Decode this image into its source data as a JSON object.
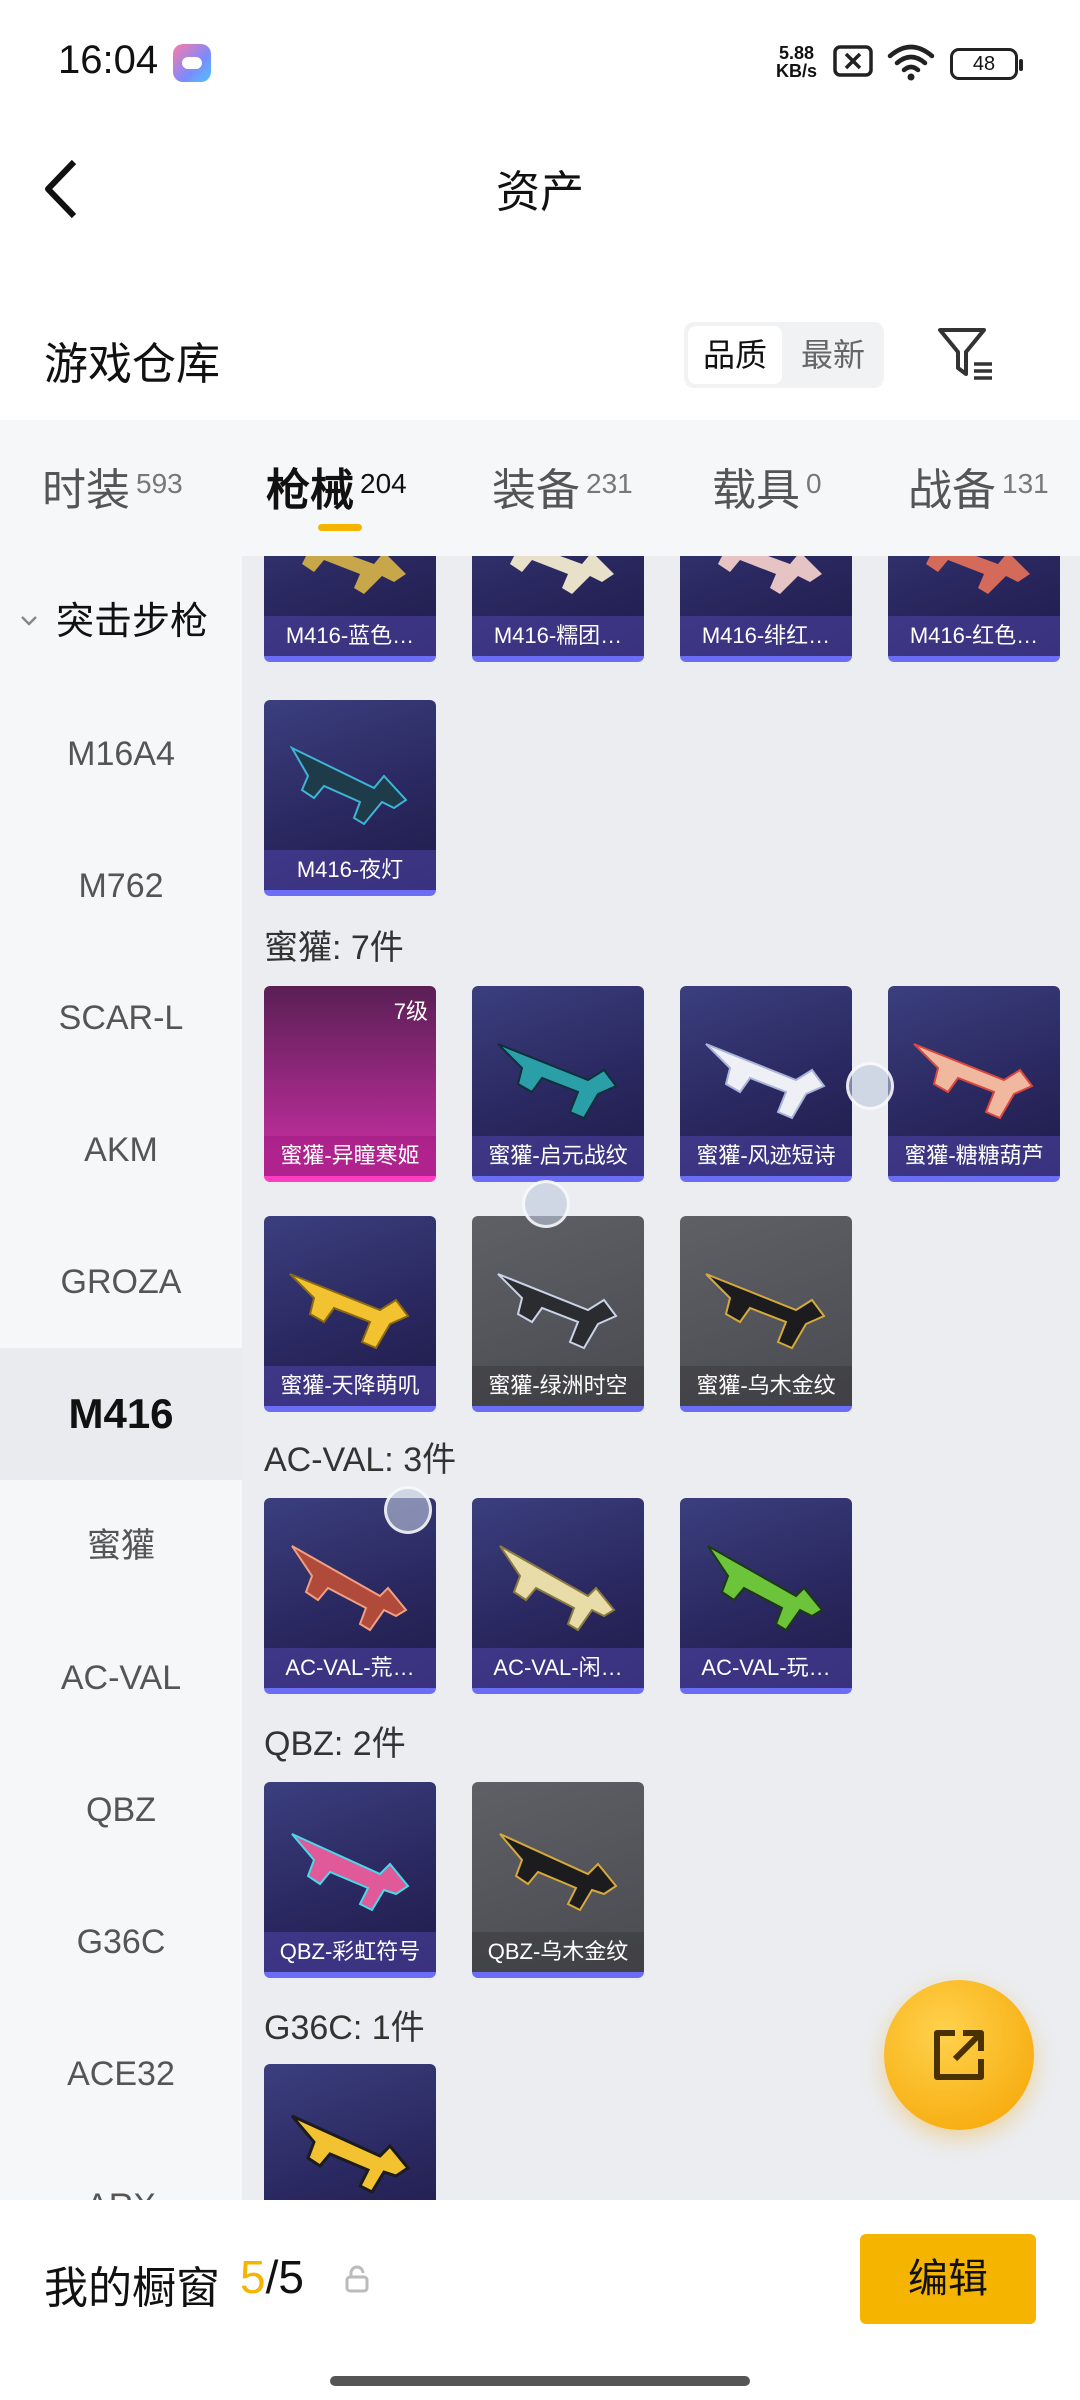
{
  "status_bar": {
    "time": "16:04",
    "net_speed_value": "5.88",
    "net_speed_unit": "KB/s",
    "battery": "48"
  },
  "header": {
    "title": "资产",
    "back_icon": "chevron-left-icon"
  },
  "warehouse": {
    "title": "游戏仓库",
    "sort_quality": "品质",
    "sort_newest": "最新",
    "filter_icon": "filter-icon"
  },
  "categories": [
    {
      "label": "时装",
      "count": "593"
    },
    {
      "label": "枪械",
      "count": "204"
    },
    {
      "label": "装备",
      "count": "231"
    },
    {
      "label": "载具",
      "count": "0"
    },
    {
      "label": "战备",
      "count": "131"
    }
  ],
  "sidebar": {
    "group": "突击步枪",
    "items": [
      "M16A4",
      "M762",
      "SCAR-L",
      "AKM",
      "GROZA",
      "M416",
      "蜜獾",
      "AC-VAL",
      "QBZ",
      "G36C",
      "ACE32",
      "ARX"
    ]
  },
  "content": {
    "m416_partial": [
      "M416-蓝色…",
      "M416-糯团…",
      "M416-绯红…",
      "M416-红色…"
    ],
    "m416_last": "M416-夜灯",
    "honey_badger_label": "蜜獾: 7件",
    "honey_badger": [
      {
        "name": "蜜獾-异瞳寒姬",
        "level": "7级"
      },
      {
        "name": "蜜獾-启元战纹"
      },
      {
        "name": "蜜獾-风迹短诗"
      },
      {
        "name": "蜜獾-糖糖葫芦"
      },
      {
        "name": "蜜獾-天降萌叽"
      },
      {
        "name": "蜜獾-绿洲时空"
      },
      {
        "name": "蜜獾-乌木金纹"
      }
    ],
    "acval_label": "AC-VAL: 3件",
    "acval": [
      "AC-VAL-荒…",
      "AC-VAL-闲…",
      "AC-VAL-玩…"
    ],
    "qbz_label": "QBZ: 2件",
    "qbz": [
      "QBZ-彩虹符号",
      "QBZ-乌木金纹"
    ],
    "g36c_label": "G36C: 1件"
  },
  "bottom": {
    "label": "我的橱窗",
    "current": "5",
    "total": "/5",
    "edit": "编辑"
  },
  "colors": {
    "accent": "#f5b400",
    "card_purple": "#2a2860",
    "card_gray": "#4a4b50",
    "card_pink": "#c22e9e"
  }
}
